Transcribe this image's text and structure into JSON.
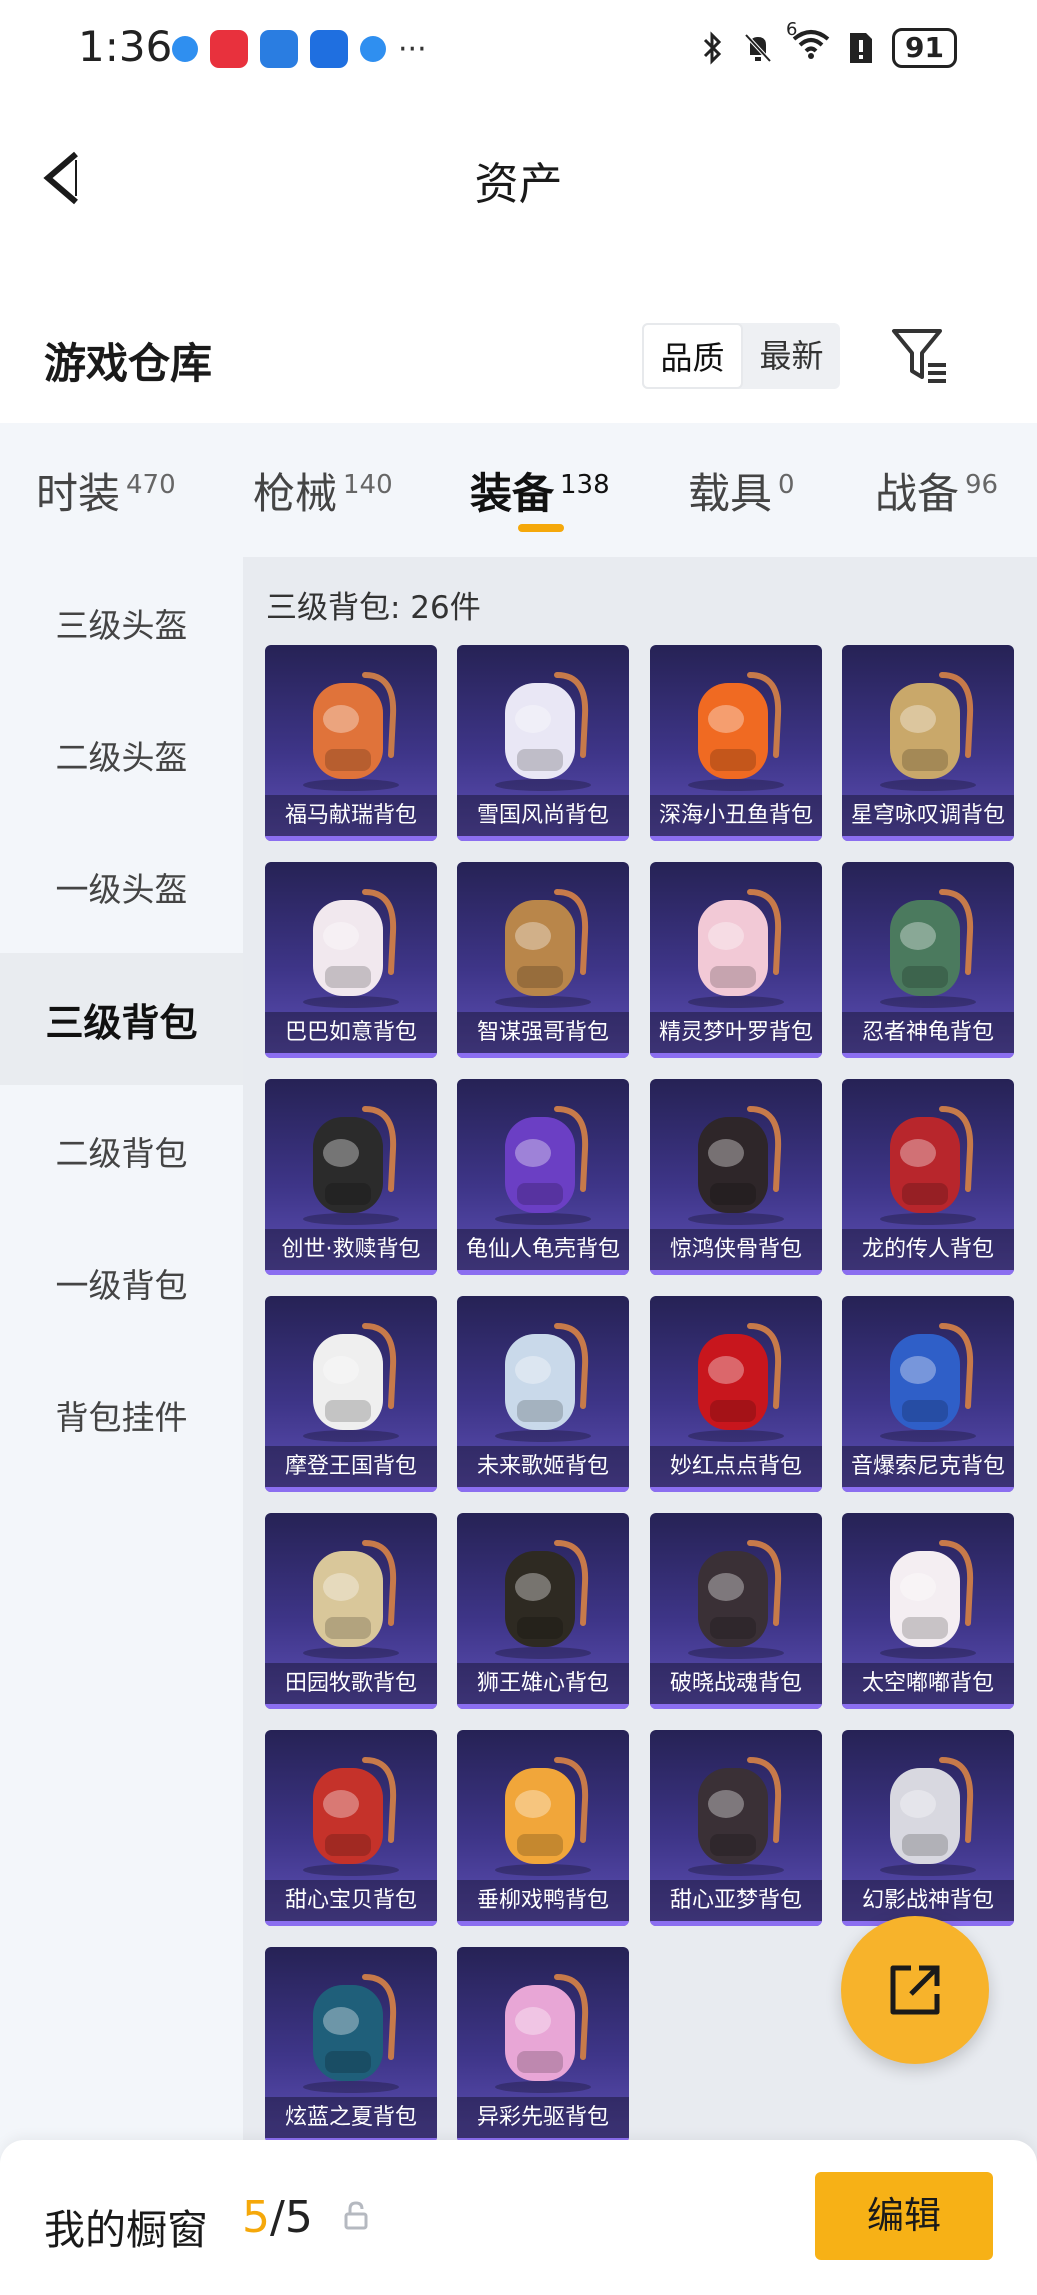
{
  "status_bar": {
    "time": "1:36",
    "network": "6",
    "battery": "91",
    "more": "···"
  },
  "header": {
    "title": "资产"
  },
  "warehouse": {
    "title": "游戏仓库",
    "sort_options": [
      "品质",
      "最新"
    ],
    "active_sort": "品质"
  },
  "tabs": [
    {
      "label": "时装",
      "count": "470"
    },
    {
      "label": "枪械",
      "count": "140"
    },
    {
      "label": "装备",
      "count": "138"
    },
    {
      "label": "载具",
      "count": "0"
    },
    {
      "label": "战备",
      "count": "96"
    }
  ],
  "active_tab": "装备",
  "sidebar": {
    "items": [
      "三级头盔",
      "二级头盔",
      "一级头盔",
      "三级背包",
      "二级背包",
      "一级背包",
      "背包挂件"
    ],
    "active": "三级背包"
  },
  "content": {
    "heading": "三级背包: 26件"
  },
  "items": [
    {
      "name": "福马献瑞背包",
      "color": "#e0733a"
    },
    {
      "name": "雪国风尚背包",
      "color": "#e9e7f5"
    },
    {
      "name": "深海小丑鱼背包",
      "color": "#f06a22"
    },
    {
      "name": "星穹咏叹调背包",
      "color": "#c9a86a"
    },
    {
      "name": "巴巴如意背包",
      "color": "#f1e8ee"
    },
    {
      "name": "智谋强哥背包",
      "color": "#b9864a"
    },
    {
      "name": "精灵梦叶罗背包",
      "color": "#f2c9d6"
    },
    {
      "name": "忍者神龟背包",
      "color": "#4b7a5e"
    },
    {
      "name": "创世·救赎背包",
      "color": "#2b2b2b"
    },
    {
      "name": "龟仙人龟壳背包",
      "color": "#6b3fc4"
    },
    {
      "name": "惊鸿侠骨背包",
      "color": "#2e2629"
    },
    {
      "name": "龙的传人背包",
      "color": "#b8262c"
    },
    {
      "name": "摩登王国背包",
      "color": "#efefef"
    },
    {
      "name": "未来歌姬背包",
      "color": "#c9d9ea"
    },
    {
      "name": "妙红点点背包",
      "color": "#c8161d"
    },
    {
      "name": "音爆索尼克背包",
      "color": "#2f5fc8"
    },
    {
      "name": "田园牧歌背包",
      "color": "#d9c79a"
    },
    {
      "name": "狮王雄心背包",
      "color": "#2e2a22"
    },
    {
      "name": "破晓战魂背包",
      "color": "#3a3036"
    },
    {
      "name": "太空嘟嘟背包",
      "color": "#f4eef2"
    },
    {
      "name": "甜心宝贝背包",
      "color": "#c5322a"
    },
    {
      "name": "垂柳戏鸭背包",
      "color": "#f1a63a"
    },
    {
      "name": "甜心亚梦背包",
      "color": "#3a3036"
    },
    {
      "name": "幻影战神背包",
      "color": "#d8d8e0"
    },
    {
      "name": "炫蓝之夏背包",
      "color": "#1f5f7a"
    },
    {
      "name": "异彩先驱背包",
      "color": "#e8a6d6"
    }
  ],
  "bottom": {
    "label": "我的橱窗",
    "current": "5",
    "separator": "/",
    "total": "5",
    "edit": "编辑"
  },
  "colors": {
    "accent": "#f5a80a",
    "card_top": "#262255",
    "card_bottom": "#5e50b6",
    "sidebar_bg": "#f3f6fa",
    "content_bg": "#e8ebf0"
  }
}
